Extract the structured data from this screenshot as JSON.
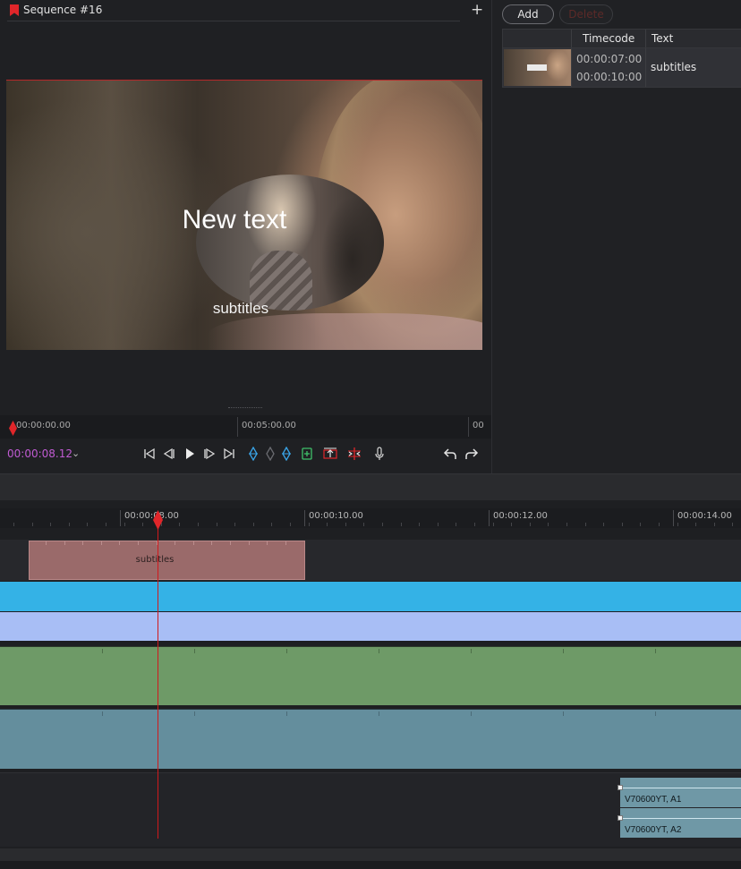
{
  "player": {
    "sequence_title": "Sequence #16",
    "add_symbol": "+",
    "overlay_title": "New text",
    "overlay_subtitle": "subtitles",
    "ruler": {
      "labels": [
        "00:00:00.00",
        "00:05:00.00",
        "00"
      ]
    },
    "current_time": "00:00:08.12",
    "dropdown_glyph": "⌄",
    "controls": [
      {
        "name": "go-to-start-icon"
      },
      {
        "name": "step-back-icon"
      },
      {
        "name": "play-icon"
      },
      {
        "name": "step-forward-icon"
      },
      {
        "name": "go-to-end-icon"
      },
      {
        "name": "mark-in-icon"
      },
      {
        "name": "marker-icon"
      },
      {
        "name": "mark-out-icon"
      },
      {
        "name": "add-clip-icon"
      },
      {
        "name": "lift-icon"
      },
      {
        "name": "extract-icon"
      },
      {
        "name": "microphone-icon"
      },
      {
        "name": "undo-icon"
      },
      {
        "name": "redo-icon"
      }
    ]
  },
  "subtitles_panel": {
    "add_label": "Add",
    "delete_label": "Delete",
    "columns": [
      "Timecode",
      "Text"
    ],
    "rows": [
      {
        "timecode_in": "00:00:07:00",
        "timecode_out": "00:00:10:00",
        "text": "subtitles"
      }
    ]
  },
  "timeline": {
    "ruler_labels": [
      "00:00:08.00",
      "00:00:10.00",
      "00:00:12.00",
      "00:00:14.00"
    ],
    "subtitle_clip_label": "subtitles",
    "audio_clips": [
      {
        "label": "V70600YT, A1"
      },
      {
        "label": "V70600YT, A2"
      }
    ]
  },
  "colors": {
    "accent_red": "#e0262a",
    "time_purple": "#c05bd2",
    "subtitle_clip": "#9a6a6a",
    "track_blue": "#34b2e6",
    "track_lavender": "#a8bef5",
    "track_green": "#6e9a67",
    "track_steel": "#648e9d"
  }
}
